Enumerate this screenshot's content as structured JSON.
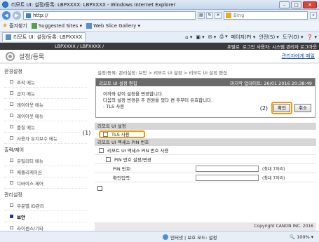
{
  "window": {
    "title": "리모트 UI: 설정/등록: LBPXXXX: LBPXXXX - Windows Internet Explorer"
  },
  "address": {
    "url": "http://",
    "search_placeholder": "Bing"
  },
  "favorites": {
    "label": "즐겨찾기",
    "items": [
      "Suggested Sites ▾",
      "Web Slice Gallery ▾"
    ]
  },
  "tab": {
    "label": "리모트 UI: 설정/등록: LBPXXXX"
  },
  "commands": {
    "page": "페이지(P) ▾",
    "safety": "안전(S) ▾",
    "tools": "도구(O) ▾",
    "help": "❓ ▾"
  },
  "page_header": {
    "product": "LBPXXXX / LBPXXXX /",
    "portal": "포털로",
    "user": "로그인 사용자: 시스템 관리자 로그아웃"
  },
  "subheader": {
    "title": "설정/등록",
    "mail_admin": "관리자에게 메일"
  },
  "sidebar": {
    "groups": [
      {
        "label": "환경설정",
        "items": [
          "조작 메뉴",
          "급지 메뉴",
          "레이아웃 메뉴",
          "레이아웃 메뉴",
          "품질 메뉴",
          "사용자 유지보수 메뉴"
        ]
      },
      {
        "label": "출력/제어",
        "items": [
          "유틸리티 메뉴",
          "애플리케이션",
          "디바이스 제어"
        ]
      },
      {
        "label": "관리설정",
        "items": [
          "부문별 ID관리",
          "보안",
          "라이센스/기타"
        ]
      }
    ],
    "active": "보안"
  },
  "breadcrumb": "설정/등록: 관리설정: 보안 > 리모트 UI 설정 > 리모트 UI 설정 편집",
  "edit": {
    "title": "리모트 UI 설정 편집",
    "updated": "마지막 업데이트: 26/01 2016 20:38:49",
    "messages": [
      "이하와 같이 설정을 변경합니다.",
      "다음의 설정 변경은 주 전원을 껐다 켠 후부터 유효합니다.",
      "- TLS 사용"
    ],
    "callout_ok": "(2)",
    "ok": "확인",
    "cancel": "취소"
  },
  "remote_ui": {
    "heading": "리모트 UI 설정",
    "callout": "(1)",
    "tls_label": "TLS 사용"
  },
  "pin": {
    "heading": "리모트 UI 액세스 PIN 번호",
    "use_label": "리모트 UI 액세스 PIN 번호 사용",
    "set_label": "PIN 번호 설정/변경",
    "pin_label": "PIN 번호:",
    "confirm_label": "확인입력:",
    "max_note": "(최대 7자리)"
  },
  "copyright": "Copyright CANON INC. 2016",
  "status": {
    "zone": "인터넷 | 보호 모드: 설정",
    "zoom": "🔍 100% ▾"
  }
}
